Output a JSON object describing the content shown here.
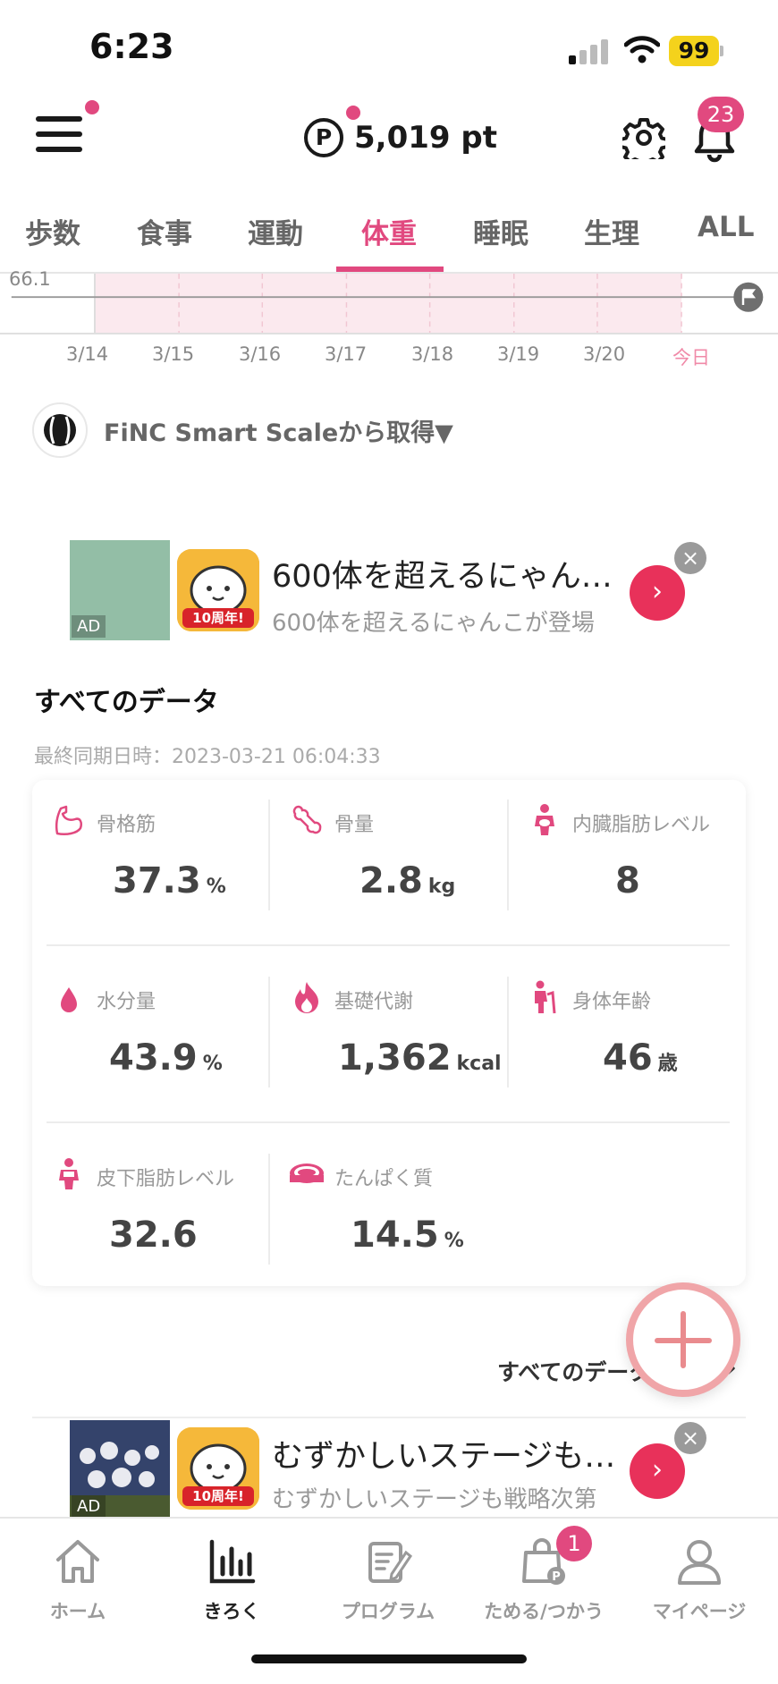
{
  "status_bar": {
    "time": "6:23",
    "battery": "99"
  },
  "header": {
    "points": "5,019 pt",
    "points_symbol": "P",
    "notification_count": "23"
  },
  "tabs": [
    {
      "label": "歩数"
    },
    {
      "label": "食事"
    },
    {
      "label": "運動"
    },
    {
      "label": "体重",
      "active": true
    },
    {
      "label": "睡眠"
    },
    {
      "label": "生理"
    },
    {
      "label": "ALL"
    }
  ],
  "chart_data": {
    "type": "line",
    "y_tick": "66.1",
    "x": [
      "3/14",
      "3/15",
      "3/16",
      "3/17",
      "3/18",
      "3/19",
      "3/20",
      "今日"
    ]
  },
  "source": {
    "label": "FiNC Smart Scaleから取得▼"
  },
  "ad1": {
    "title": "600体を超えるにゃん…",
    "subtitle": "600体を超えるにゃんこが登場",
    "ad_label": "AD",
    "icon_text": "10周年!",
    "arrow": "›",
    "close": "×"
  },
  "all_data": {
    "title": "すべてのデータ",
    "last_sync": "最終同期日時：2023-03-21 06:04:33",
    "metrics": [
      {
        "label": "骨格筋",
        "value": "37.3",
        "unit": "%"
      },
      {
        "label": "骨量",
        "value": "2.8",
        "unit": "kg"
      },
      {
        "label": "内臓脂肪レベル",
        "value": "8",
        "unit": ""
      },
      {
        "label": "水分量",
        "value": "43.9",
        "unit": "%"
      },
      {
        "label": "基礎代謝",
        "value": "1,362",
        "unit": "kcal"
      },
      {
        "label": "身体年齢",
        "value": "46",
        "unit": "歳"
      },
      {
        "label": "皮下脂肪レベル",
        "value": "32.6",
        "unit": ""
      },
      {
        "label": "たんぱく質",
        "value": "14.5",
        "unit": "%"
      }
    ],
    "link": "すべてのデータ",
    "link_chevron": "›"
  },
  "ad2": {
    "title": "むずかしいステージも…",
    "subtitle": "むずかしいステージも戦略次第",
    "ad_label": "AD",
    "icon_text": "10周年!",
    "arrow": "›",
    "close": "×"
  },
  "bottom_nav": {
    "items": [
      {
        "label": "ホーム"
      },
      {
        "label": "きろく",
        "active": true
      },
      {
        "label": "プログラム"
      },
      {
        "label": "ためる/つかう"
      },
      {
        "label": "マイページ"
      }
    ],
    "badge": "1"
  },
  "colors": {
    "accent": "#e1497f",
    "chart_band": "#fbe9ee",
    "ad_arrow": "#e8315a"
  }
}
